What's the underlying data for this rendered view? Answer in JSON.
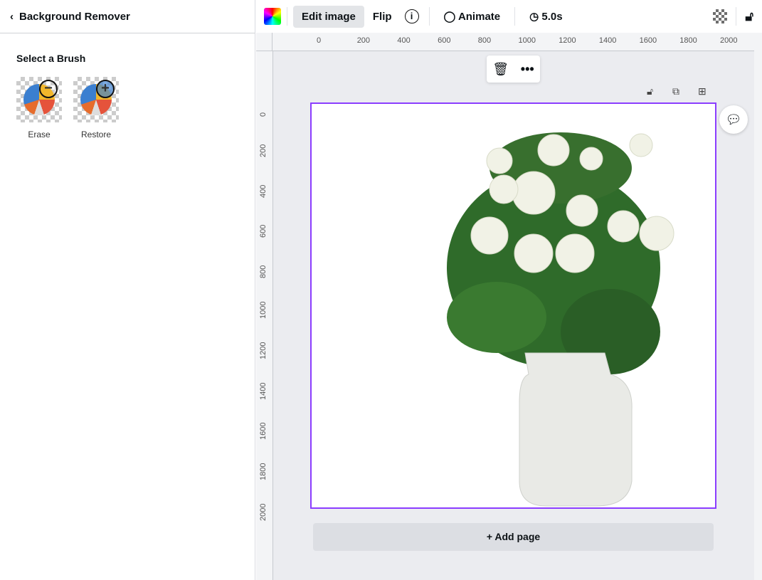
{
  "sidebar": {
    "title": "Background Remover",
    "section": "Select a Brush",
    "brushes": [
      {
        "label": "Erase",
        "icon": "minus-icon"
      },
      {
        "label": "Restore",
        "icon": "plus-icon"
      }
    ]
  },
  "toolbar": {
    "edit_image": "Edit image",
    "flip": "Flip",
    "animate": "Animate",
    "duration": "5.0s"
  },
  "ruler": {
    "h": [
      "0",
      "200",
      "400",
      "600",
      "800",
      "1000",
      "1200",
      "1400",
      "1600",
      "1800",
      "2000"
    ],
    "v": [
      "0",
      "200",
      "400",
      "600",
      "800",
      "1000",
      "1200",
      "1400",
      "1600",
      "1800",
      "2000"
    ]
  },
  "canvas": {
    "add_page": "+ Add page",
    "selection_color": "#8b3dff"
  }
}
